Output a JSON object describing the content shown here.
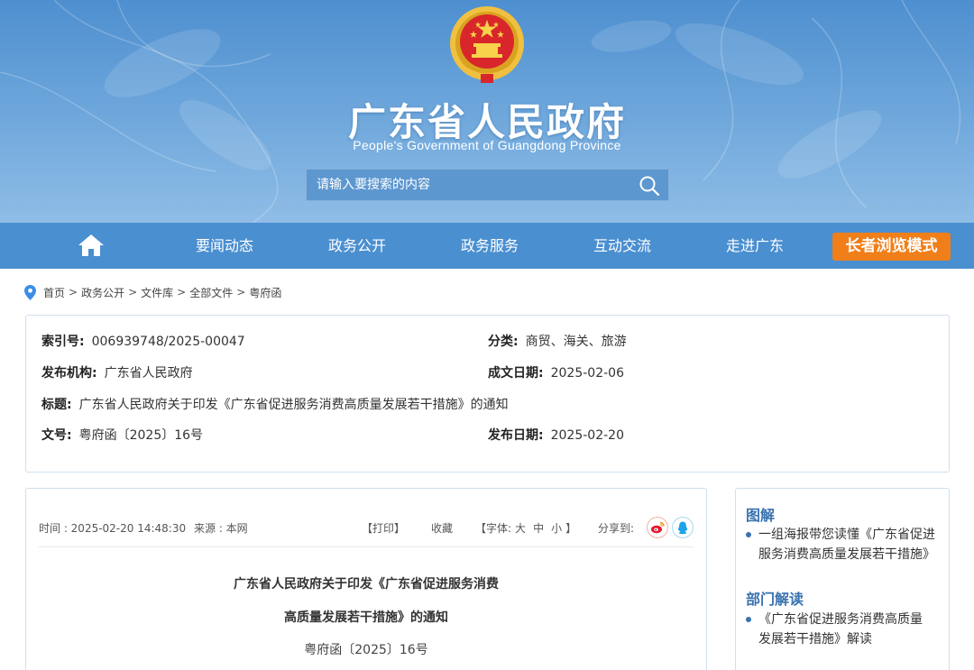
{
  "header": {
    "title": "广东省人民政府",
    "subtitle": "People's Government of Guangdong Province",
    "search_placeholder": "请输入要搜索的内容"
  },
  "nav": {
    "items": [
      {
        "label": "要闻动态"
      },
      {
        "label": "政务公开"
      },
      {
        "label": "政务服务"
      },
      {
        "label": "互动交流"
      },
      {
        "label": "走进广东"
      }
    ],
    "elder_mode": "长者浏览模式"
  },
  "breadcrumb": {
    "items": [
      "首页",
      "政务公开",
      "文件库",
      "全部文件",
      "粤府函"
    ],
    "separator": ">"
  },
  "info": {
    "index_label": "索引号:",
    "index_value": "006939748/2025-00047",
    "category_label": "分类:",
    "category_value": "商贸、海关、旅游",
    "publisher_label": "发布机构:",
    "publisher_value": "广东省人民政府",
    "created_label": "成文日期:",
    "created_value": "2025-02-06",
    "title_label": "标题:",
    "title_value": "广东省人民政府关于印发《广东省促进服务消费高质量发展若干措施》的通知",
    "docno_label": "文号:",
    "docno_value": "粤府函〔2025〕16号",
    "published_label": "发布日期:",
    "published_value": "2025-02-20"
  },
  "article": {
    "time": "时间 : 2025-02-20 14:48:30",
    "source": "来源 : 本网",
    "print": "【打印】",
    "favorite": "收藏",
    "font_prefix": "【字体:",
    "font_large": "大",
    "font_medium": "中",
    "font_small": "小",
    "font_suffix": "】",
    "share": "分享到:",
    "title_line1": "广东省人民政府关于印发《广东省促进服务消费",
    "title_line2": "高质量发展若干措施》的通知",
    "doc_number": "粤府函〔2025〕16号"
  },
  "sidebar": {
    "sections": [
      {
        "heading": "图解",
        "items": [
          {
            "line1": "一组海报带您读懂《广东省促进",
            "line2": "服务消费高质量发展若干措施》"
          }
        ]
      },
      {
        "heading": "部门解读",
        "items": [
          {
            "line1": "《广东省促进服务消费高质量",
            "line2": "发展若干措施》解读"
          }
        ]
      }
    ]
  },
  "colors": {
    "nav_blue": "#4a8fd0",
    "elder_orange": "#f07f1a",
    "heading_blue": "#3a72b0",
    "weibo_red": "#e6162d",
    "qq_blue": "#1fa3e6"
  },
  "icons": [
    "home-icon",
    "search-icon",
    "location-pin-icon",
    "weibo-icon",
    "qq-icon",
    "national-emblem"
  ]
}
